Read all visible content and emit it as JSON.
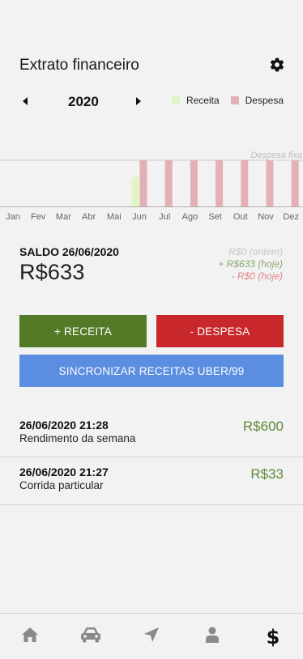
{
  "header": {
    "title": "Extrato financeiro",
    "settings_icon": "gear-icon"
  },
  "year_nav": {
    "year": "2020",
    "prev_icon": "caret-left-icon",
    "next_icon": "caret-right-icon"
  },
  "legend": {
    "income_label": "Receita",
    "income_color": "#e2f3c6",
    "expense_label": "Despesa",
    "expense_color": "#e3b0b6"
  },
  "chart_data": {
    "type": "bar",
    "categories": [
      "Jan",
      "Fev",
      "Mar",
      "Abr",
      "Mai",
      "Jun",
      "Jul",
      "Ago",
      "Set",
      "Out",
      "Nov",
      "Dez"
    ],
    "series": [
      {
        "name": "Receita",
        "values": [
          0,
          0,
          0,
          0,
          0,
          633,
          0,
          0,
          0,
          0,
          0,
          0
        ]
      },
      {
        "name": "Despesa",
        "values": [
          0,
          0,
          0,
          0,
          0,
          1000,
          1000,
          1000,
          1000,
          1000,
          1000,
          1000
        ]
      }
    ],
    "reference_line": {
      "label": "Despesa fixa",
      "value": 1000
    },
    "ylim": [
      0,
      1000
    ],
    "grid": false
  },
  "saldo": {
    "label": "SALDO 26/06/2020",
    "value": "R$633",
    "yesterday": "R$0 (ontem)",
    "income_today": "+ R$633 (hoje)",
    "expense_today": "- R$0 (hoje)"
  },
  "buttons": {
    "add_income": "+ RECEITA",
    "add_expense": "- DESPESA",
    "sync": "SINCRONIZAR RECEITAS UBER/99"
  },
  "transactions": [
    {
      "datetime": "26/06/2020 21:28",
      "description": "Rendimento da semana",
      "amount": "R$600"
    },
    {
      "datetime": "26/06/2020 21:27",
      "description": "Corrida particular",
      "amount": "R$33"
    }
  ],
  "bottom_nav": {
    "items": [
      "home-icon",
      "car-icon",
      "location-arrow-icon",
      "user-icon",
      "dollar-icon"
    ],
    "dollar_symbol": "$"
  }
}
